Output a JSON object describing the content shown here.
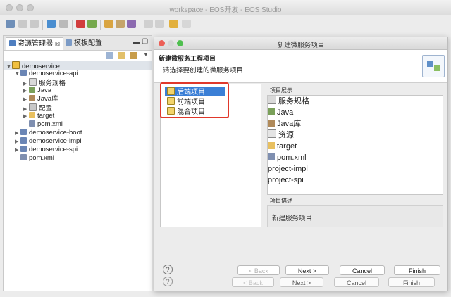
{
  "window": {
    "title": "workspace - EOS开发 - EOS Studio"
  },
  "explorer": {
    "tabs": [
      {
        "label": "资源管理器"
      },
      {
        "label": "模板配置"
      }
    ],
    "tree": [
      {
        "label": "demoservice",
        "icon": "project-folder-icon"
      },
      {
        "label": "demoservice-api",
        "icon": "project-icon"
      },
      {
        "label": "服务规格",
        "icon": "service-spec-icon"
      },
      {
        "label": "Java",
        "icon": "java-package-icon"
      },
      {
        "label": "Java库",
        "icon": "library-icon"
      },
      {
        "label": "配置",
        "icon": "config-icon"
      },
      {
        "label": "target",
        "icon": "folder-icon"
      },
      {
        "label": "pom.xml",
        "icon": "xml-file-icon"
      },
      {
        "label": "demoservice-boot",
        "icon": "project-icon"
      },
      {
        "label": "demoservice-impl",
        "icon": "project-icon"
      },
      {
        "label": "demoservice-spi",
        "icon": "project-icon"
      },
      {
        "label": "pom.xml",
        "icon": "xml-file-icon"
      }
    ]
  },
  "dialog": {
    "title": "新建微服务项目",
    "header_title": "新建微服务工程项目",
    "header_subtitle": "请选择要创建的微服务项目",
    "project_types": [
      {
        "label": "后端项目",
        "selected": true
      },
      {
        "label": "前端项目",
        "selected": false
      },
      {
        "label": "混合项目",
        "selected": false
      }
    ],
    "preview_label": "项目展示",
    "preview_items": [
      {
        "label": "服务规格"
      },
      {
        "label": "Java"
      },
      {
        "label": "Java库"
      },
      {
        "label": "资源"
      },
      {
        "label": "target"
      },
      {
        "label": "pom.xml"
      },
      {
        "label": "project-impl"
      },
      {
        "label": "project-spi"
      }
    ],
    "description_label": "项目描述",
    "description_text": "新建服务项目",
    "buttons": {
      "help": "?",
      "back": "< Back",
      "next": "Next >",
      "cancel": "Cancel",
      "finish": "Finish"
    }
  },
  "colors": {
    "selection": "#3b7fd6",
    "highlight_box": "#e0382b"
  }
}
